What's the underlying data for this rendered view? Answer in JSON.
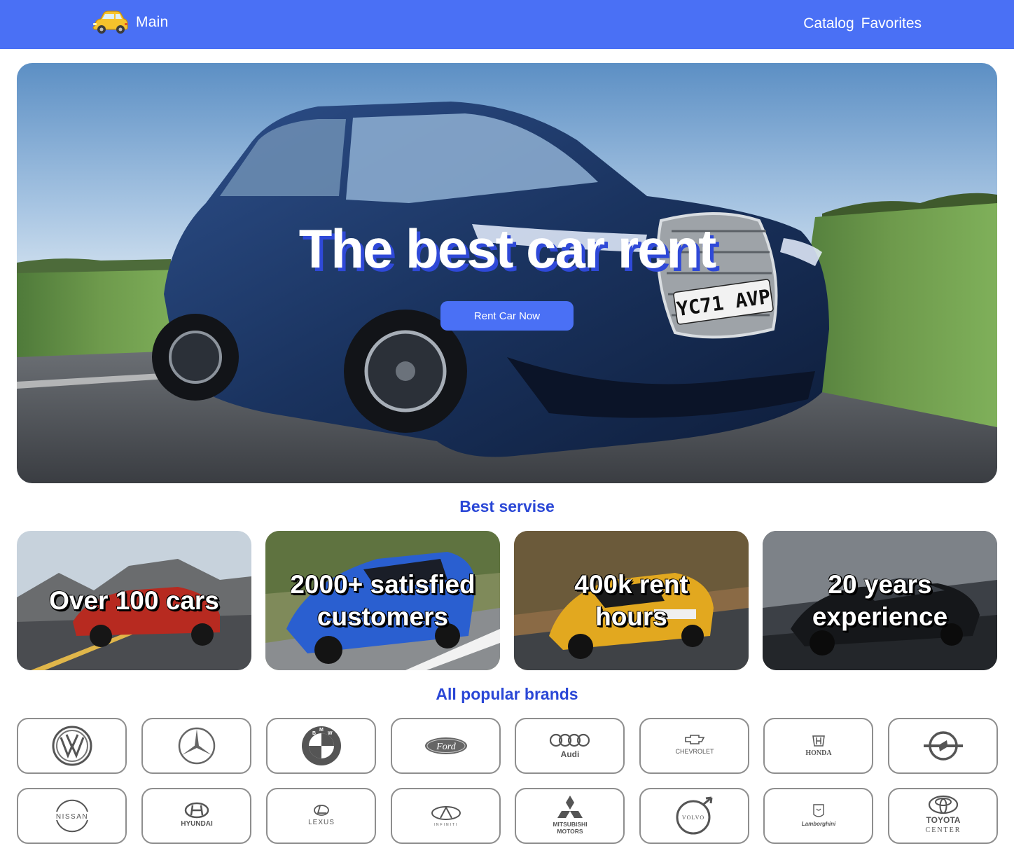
{
  "header": {
    "brand_icon": "car-icon",
    "brand_label": "Main",
    "nav": [
      {
        "label": "Catalog"
      },
      {
        "label": "Favorites"
      }
    ]
  },
  "hero": {
    "title": "The best car rent",
    "button_label": "Rent Car Now",
    "license_plate": "YC71 AVP"
  },
  "services": {
    "title": "Best servise",
    "cards": [
      {
        "text": "Over 100 cars"
      },
      {
        "text": "2000+ satisfied customers"
      },
      {
        "text": "400k rent hours"
      },
      {
        "text": "20 years experience"
      }
    ]
  },
  "brands": {
    "title": "All popular brands",
    "items": [
      {
        "name": "Volkswagen",
        "icon": "volkswagen-logo-icon",
        "text": ""
      },
      {
        "name": "Mercedes-Benz",
        "icon": "mercedes-logo-icon",
        "text": ""
      },
      {
        "name": "BMW",
        "icon": "bmw-logo-icon",
        "text": ""
      },
      {
        "name": "Ford",
        "icon": "ford-logo-icon",
        "text": "Ford"
      },
      {
        "name": "Audi",
        "icon": "audi-logo-icon",
        "text": "Audi"
      },
      {
        "name": "Chevrolet",
        "icon": "chevrolet-logo-icon",
        "text": "CHEVROLET"
      },
      {
        "name": "Honda",
        "icon": "honda-logo-icon",
        "text": "HONDA"
      },
      {
        "name": "Opel",
        "icon": "opel-logo-icon",
        "text": ""
      },
      {
        "name": "Nissan",
        "icon": "nissan-logo-icon",
        "text": "NISSAN"
      },
      {
        "name": "Hyundai",
        "icon": "hyundai-logo-icon",
        "text": "HYUNDAI"
      },
      {
        "name": "Lexus",
        "icon": "lexus-logo-icon",
        "text": "LEXUS"
      },
      {
        "name": "Infiniti",
        "icon": "infiniti-logo-icon",
        "text": "INFINITI"
      },
      {
        "name": "Mitsubishi Motors",
        "icon": "mitsubishi-logo-icon",
        "text": "MITSUBISHI MOTORS"
      },
      {
        "name": "Volvo",
        "icon": "volvo-logo-icon",
        "text": "VOLVO"
      },
      {
        "name": "Lamborghini",
        "icon": "lamborghini-logo-icon",
        "text": "Lamborghini"
      },
      {
        "name": "Toyota Center",
        "icon": "toyota-logo-icon",
        "text": "TOYOTA CENTER"
      }
    ]
  },
  "colors": {
    "header_bg": "#4a70f5",
    "accent": "#4a70f5",
    "section_title": "#2a47d6",
    "title_shadow": "#2f49d8",
    "brand_border": "#8e8e8e"
  }
}
